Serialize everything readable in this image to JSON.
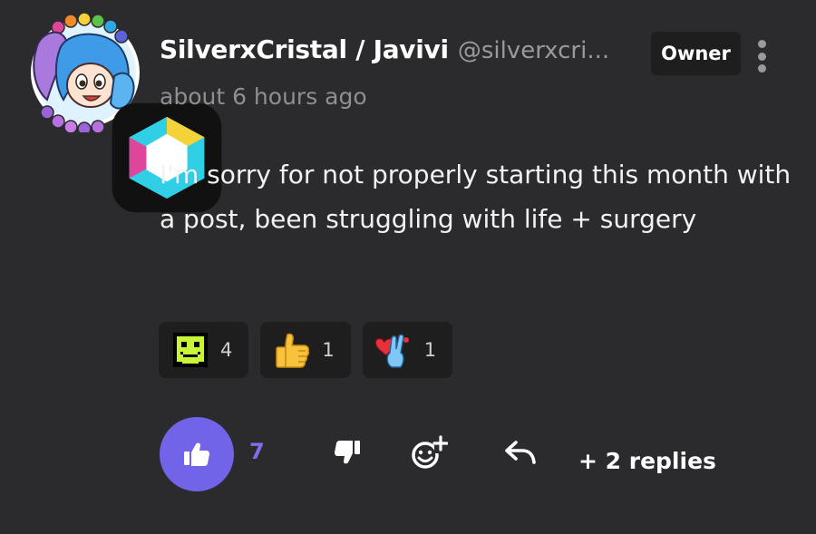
{
  "author": {
    "name": "SilverxCristal / Javivi",
    "handle": "@silverxcri...",
    "role_badge": "Owner",
    "timestamp": "about 6 hours ago",
    "avatar": "character-avatar-icon"
  },
  "comment": {
    "text": "I'm sorry for not properly starting this month with a post, been struggling with life + surgery"
  },
  "reactions": [
    {
      "icon": "green-pixel-face-icon",
      "count": "4"
    },
    {
      "icon": "thumbs-up-emoji-icon",
      "count": "1"
    },
    {
      "icon": "heart-peace-hand-icon",
      "count": "1"
    }
  ],
  "actions": {
    "like_count": "7",
    "replies_label": "+ 2 replies"
  },
  "colors": {
    "background": "#2b2b2d",
    "accent": "#7264e8",
    "chip": "#1e1e1f",
    "muted": "#9a9a9e"
  }
}
